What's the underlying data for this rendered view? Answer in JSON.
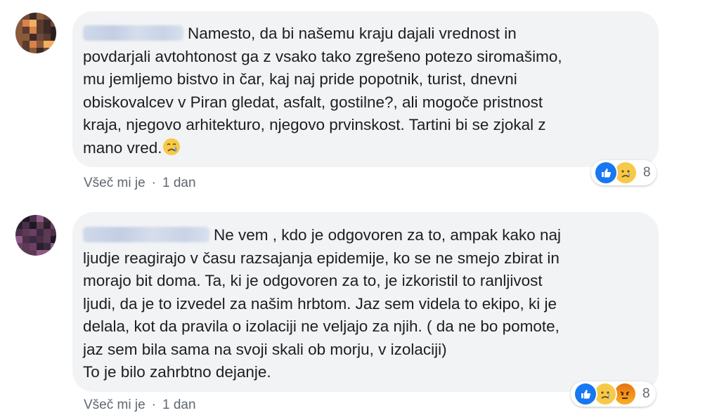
{
  "comments": [
    {
      "text": "Namesto, da bi našemu kraju dajali vrednost in\npovdarjali avtohtonost ga z vsako tako zgrešeno potezo siromašimo,\nmu jemljemo bistvo in čar, kaj naj pride popotnik, turist, dnevni\nobiskovalcev v Piran gledat, asfalt, gostilne?, ali mogoče pristnost\nkraja, njegovo arhitekturo, njegovo prvinskost. Tartini bi se zjokal z\nmano vred.",
      "inline_emoji": "crying-face",
      "reactions": [
        "like",
        "sad"
      ],
      "reaction_count": "8",
      "like_label": "Všeč mi je",
      "separator": "·",
      "time": "1 dan"
    },
    {
      "text": "Ne vem , kdo je odgovoren za to, ampak kako naj\nljudje reagirajo v času razsajanja epidemije, ko se ne smejo zbirat in\nmorajo bit doma. Ta, ki je odgovoren za to, je izkoristil to ranljivost\nljudi, da je to izvedel za našim hrbtom. Jaz sem videla to ekipo, ki je\ndelala, kot da pravila o izolaciji ne veljajo za njih. ( da ne bo pomote,\njaz sem bila sama na svoji skali ob morju, v izolaciji)\nTo je bilo zahrbtno dejanje.",
      "reactions": [
        "like",
        "sad",
        "angry"
      ],
      "reaction_count": "8",
      "like_label": "Všeč mi je",
      "separator": "·",
      "time": "1 dan"
    }
  ],
  "colors": {
    "bubble": "#f2f3f5",
    "text": "#1c1e21",
    "meta": "#606770",
    "like_blue": "#1877f2",
    "sad_yellow": "#f7c948"
  }
}
